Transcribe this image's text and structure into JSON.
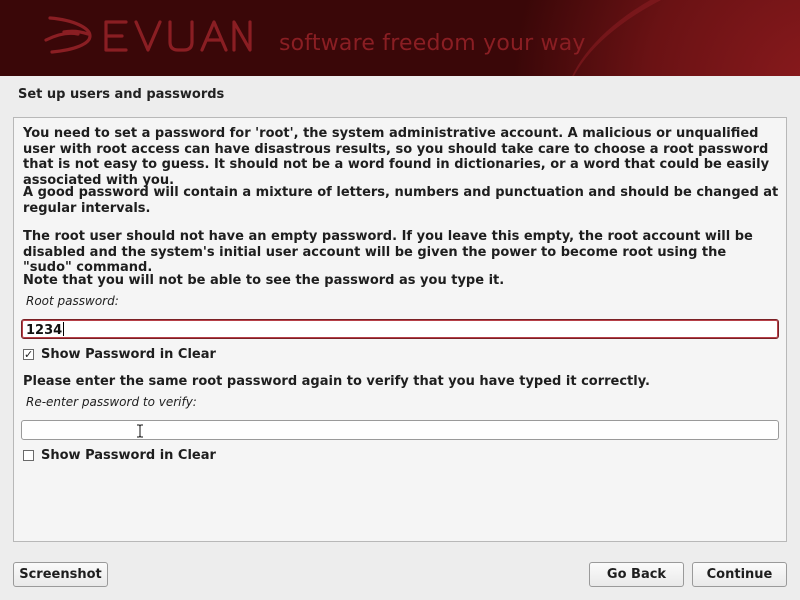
{
  "banner": {
    "logo_text": "DEVUAN",
    "tagline": "software freedom your way"
  },
  "page": {
    "title": "Set up users and passwords"
  },
  "content": {
    "paragraphs": [
      "You need to set a password for 'root', the system administrative account. A malicious or unqualified user with root access can have disastrous results, so you should take care to choose a root password that is not easy to guess. It should not be a word found in dictionaries, or a word that could be easily associated with you.",
      "A good password will contain a mixture of letters, numbers and punctuation and should be changed at regular intervals.",
      "The root user should not have an empty password. If you leave this empty, the root account will be disabled and the system's initial user account will be given the power to become root using the \"sudo\" command.",
      "Note that you will not be able to see the password as you type it."
    ],
    "root_password": {
      "label": "Root password:",
      "value": "1234",
      "show_clear_label": "Show Password in Clear",
      "show_clear_checked": true
    },
    "verify_prompt": "Please enter the same root password again to verify that you have typed it correctly.",
    "verify_password": {
      "label": "Re-enter password to verify:",
      "value": "",
      "show_clear_label": "Show Password in Clear",
      "show_clear_checked": false
    }
  },
  "buttons": {
    "screenshot": "Screenshot",
    "go_back": "Go Back",
    "continue": "Continue"
  },
  "colors": {
    "banner_bg": "#3a0708",
    "banner_accent": "#8a1e23",
    "page_bg": "#ededed",
    "panel_bg": "#f5f5f5",
    "focus_border": "#7a2025"
  }
}
